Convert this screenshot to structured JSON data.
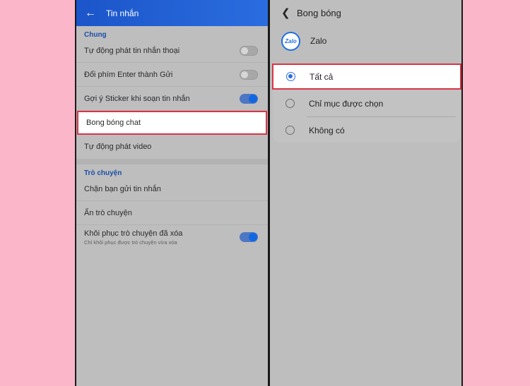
{
  "left_screen": {
    "title": "Tin nhắn",
    "back_icon": "arrow-left-icon",
    "sections": [
      {
        "header": "Chung",
        "rows": [
          {
            "label": "Tự động phát tin nhắn thoại",
            "toggle": "off"
          },
          {
            "label": "Đổi phím Enter thành Gửi",
            "toggle": "off"
          },
          {
            "label": "Gợi ý Sticker khi soạn tin nhắn",
            "toggle": "on"
          },
          {
            "label": "Bong bóng chat"
          },
          {
            "label": "Tự động phát video"
          }
        ]
      },
      {
        "header": "Trò chuyện",
        "rows": [
          {
            "label": "Chặn bạn gửi tin nhắn"
          },
          {
            "label": "Ẩn trò chuyện"
          },
          {
            "label": "Khôi phục trò chuyện đã xóa",
            "sub": "Chỉ khôi phục được trò chuyện vừa xóa",
            "toggle": "on"
          }
        ]
      }
    ]
  },
  "right_screen": {
    "title": "Bong bóng",
    "back_icon": "chevron-left-icon",
    "app": {
      "logo_text": "Zalo",
      "name": "Zalo"
    },
    "options": [
      {
        "label": "Tất cả",
        "selected": true
      },
      {
        "label": "Chỉ mục được chọn",
        "selected": false
      },
      {
        "label": "Không có",
        "selected": false
      }
    ]
  },
  "colors": {
    "background": "#fbb6c9",
    "highlight_border": "#d93445",
    "accent_blue": "#1167e0",
    "topbar_blue": "#1b55c9"
  }
}
